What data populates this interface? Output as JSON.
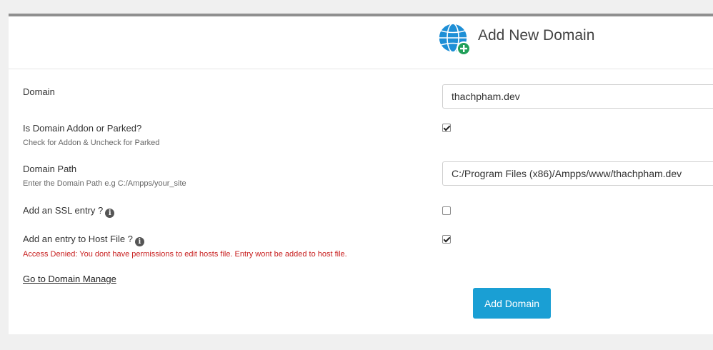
{
  "header": {
    "title": "Add New Domain",
    "icon": "globe-add-icon"
  },
  "form": {
    "domain": {
      "label": "Domain",
      "value": "thachpham.dev"
    },
    "addon": {
      "label": "Is Domain Addon or Parked?",
      "help": "Check for Addon & Uncheck for Parked",
      "checked": true
    },
    "path": {
      "label": "Domain Path",
      "help": "Enter the Domain Path e.g C:/Ampps/your_site",
      "value": "C:/Program Files (x86)/Ampps/www/thachpham.dev"
    },
    "ssl": {
      "label": "Add an SSL entry ?",
      "checked": false
    },
    "hosts": {
      "label": "Add an entry to Host File ?",
      "error": "Access Denied: You dont have permissions to edit hosts file. Entry wont be added to host file.",
      "checked": true
    },
    "manage_link": "Go to Domain Manage",
    "submit_label": "Add Domain"
  },
  "colors": {
    "accent": "#1a9fd4",
    "error": "#c82020",
    "globe": "#1e8fd6",
    "plus_badge": "#22a05a"
  }
}
